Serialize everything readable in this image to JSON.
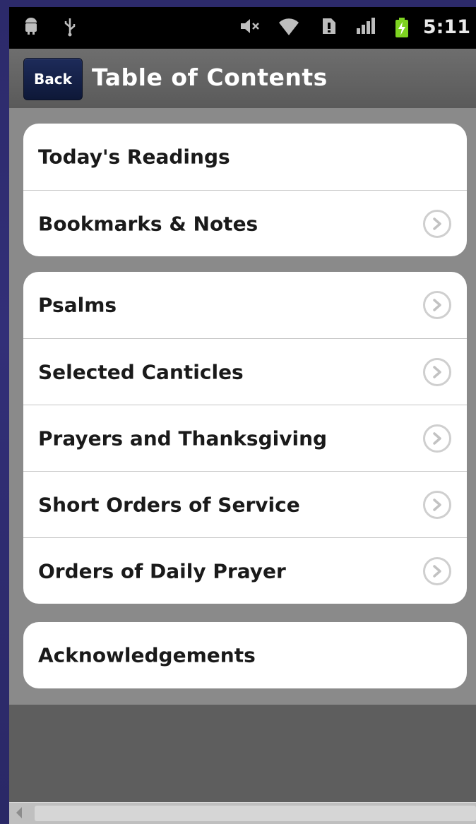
{
  "status_bar": {
    "time": "5:11",
    "icons": [
      "android-icon",
      "usb-icon",
      "mute-icon",
      "wifi-icon",
      "sim-icon",
      "signal-icon",
      "battery-charging-icon"
    ]
  },
  "header": {
    "back_label": "Back",
    "title": "Table of Contents"
  },
  "groups": [
    {
      "items": [
        {
          "label": "Today's Readings",
          "chevron": false
        },
        {
          "label": "Bookmarks & Notes",
          "chevron": true
        }
      ]
    },
    {
      "items": [
        {
          "label": "Psalms",
          "chevron": true
        },
        {
          "label": "Selected Canticles",
          "chevron": true
        },
        {
          "label": "Prayers and Thanksgiving",
          "chevron": true
        },
        {
          "label": "Short Orders of Service",
          "chevron": true
        },
        {
          "label": "Orders of Daily Prayer",
          "chevron": true
        }
      ]
    },
    {
      "items": [
        {
          "label": "Acknowledgements",
          "chevron": false
        }
      ]
    }
  ],
  "colors": {
    "back_button": "#142250",
    "title_bar": "#636363",
    "list_background": "#8a8a8a",
    "battery": "#7ed321"
  }
}
